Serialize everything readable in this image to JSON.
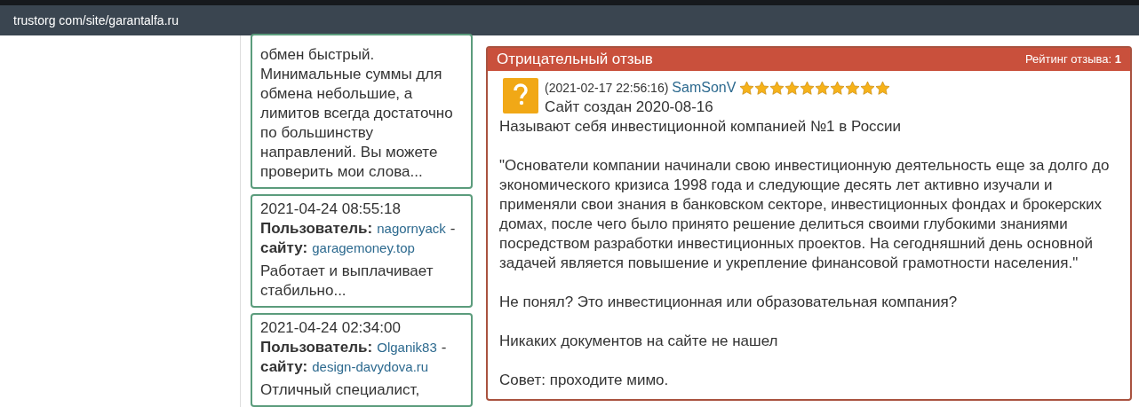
{
  "address_bar": {
    "url": "trustorg com/site/garantalfa.ru"
  },
  "feed": [
    {
      "text": "обмен быстрый. Минимальные суммы для обмена небольшие, а лимитов всегда достаточно по большинству направлений. Вы можете проверить мои слова..."
    },
    {
      "date": "2021-04-24 08:55:18",
      "user_label": "Пользователь:",
      "user": "nagornyack",
      "separator": "-",
      "site_label": "сайту:",
      "site": "garagemoney.top",
      "text": "Работает и выплачивает стабильно..."
    },
    {
      "date": "2021-04-24 02:34:00",
      "user_label": "Пользователь:",
      "user": "Olganik83",
      "separator": "-",
      "site_label": "сайту:",
      "site": "design-davydova.ru",
      "text": "Отличный специалист,"
    }
  ],
  "review": {
    "title": "Отрицательный отзыв",
    "rating_label": "Рейтинг отзыва:",
    "rating": "1",
    "date": "(2021-02-17 22:56:16)",
    "author": "SamSonV",
    "stars": 10,
    "first_line": "Сайт создан 2020-08-16",
    "paragraphs": [
      "Называют себя инвестиционной компанией №1 в России",
      "\"Основатели компании начинали свою инвестиционную деятельность еще за долго до экономического кризиса 1998 года и следующие десять лет активно изучали и применяли свои знания в банковском секторе, инвестиционных фондах и брокерских домах, после чего было принято решение делиться своими глубокими знаниями посредством разработки инвестиционных проектов. На сегодняшний день основной задачей является повышение и укрепление финансовой грамотности населения.\"",
      "Не понял? Это инвестиционная или образовательная компания?",
      "Никаких документов на сайте не нашел",
      "Совет: проходите мимо."
    ]
  }
}
